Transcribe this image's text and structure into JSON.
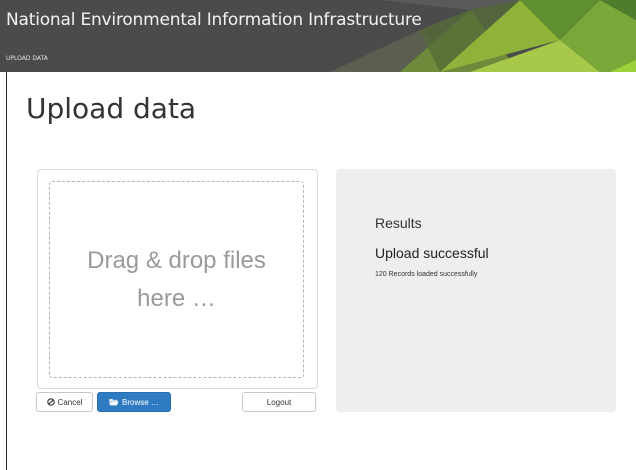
{
  "header": {
    "site_title": "National Environmental Information Infrastructure",
    "breadcrumb": "UPLOAD DATA"
  },
  "page": {
    "title": "Upload data"
  },
  "dropzone": {
    "text": "Drag & drop files here …"
  },
  "buttons": {
    "cancel": "Cancel",
    "browse": "Browse …",
    "logout": "Logout"
  },
  "results": {
    "title": "Results",
    "status": "Upload successful",
    "detail": "120 Records loaded successfully"
  },
  "icons": {
    "cancel": "cancel-icon",
    "browse": "folder-open-icon"
  },
  "colors": {
    "banner": "#4a4a4a",
    "browse_button": "#2f7bc1",
    "results_panel": "#eeeeee"
  }
}
